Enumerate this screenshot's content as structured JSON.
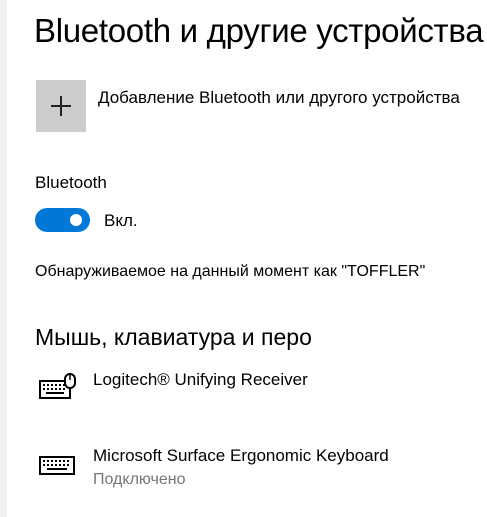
{
  "page": {
    "title": "Bluetooth и другие устройства"
  },
  "add_device": {
    "label": "Добавление Bluetooth или другого устройства",
    "icon": "plus-icon"
  },
  "bluetooth": {
    "label": "Bluetooth",
    "toggle_on": true,
    "toggle_state_label": "Вкл.",
    "accent_color": "#0078d7",
    "discoverable_text": "Обнаруживаемое на данный момент как \"TOFFLER\""
  },
  "mouse_keyboard_pen": {
    "heading": "Мышь, клавиатура и перо",
    "devices": [
      {
        "name": "Logitech® Unifying Receiver",
        "status": "",
        "icon": "keyboard-mouse-icon"
      },
      {
        "name": "Microsoft Surface Ergonomic Keyboard",
        "status": "Подключено",
        "icon": "keyboard-icon"
      }
    ]
  }
}
